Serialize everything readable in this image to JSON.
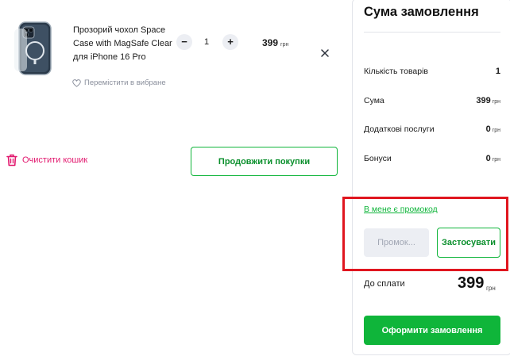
{
  "cart": {
    "item": {
      "name": "Прозорий чохол Space Case with MagSafe Clear для iPhone 16 Pro",
      "quantity": "1",
      "qty_minus": "−",
      "qty_plus": "+",
      "price": "399",
      "currency": "грн",
      "favorite_label": "Перемістити в вибране",
      "remove_icon": "close-icon",
      "favorite_icon": "heart-icon"
    },
    "clear_label": "Очистити кошик",
    "clear_icon": "trash-icon",
    "continue_label": "Продовжити покупки"
  },
  "summary": {
    "title": "Сума замовлення",
    "rows": [
      {
        "label": "Кількість товарів",
        "value": "1",
        "currency": ""
      },
      {
        "label": "Сума",
        "value": "399",
        "currency": "грн"
      },
      {
        "label": "Додаткові послуги",
        "value": "0",
        "currency": "грн"
      },
      {
        "label": "Бонуси",
        "value": "0",
        "currency": "грн"
      }
    ],
    "promo_link": "В мене є промокод",
    "promo_placeholder": "Промок...",
    "apply_label": "Застосувати",
    "total_label": "До сплати",
    "total_value": "399",
    "total_currency": "грн",
    "checkout_label": "Оформити замовлення"
  },
  "colors": {
    "accent_green": "#0fb53a",
    "danger_pink": "#e2186e",
    "highlight_red": "#e0161f"
  }
}
